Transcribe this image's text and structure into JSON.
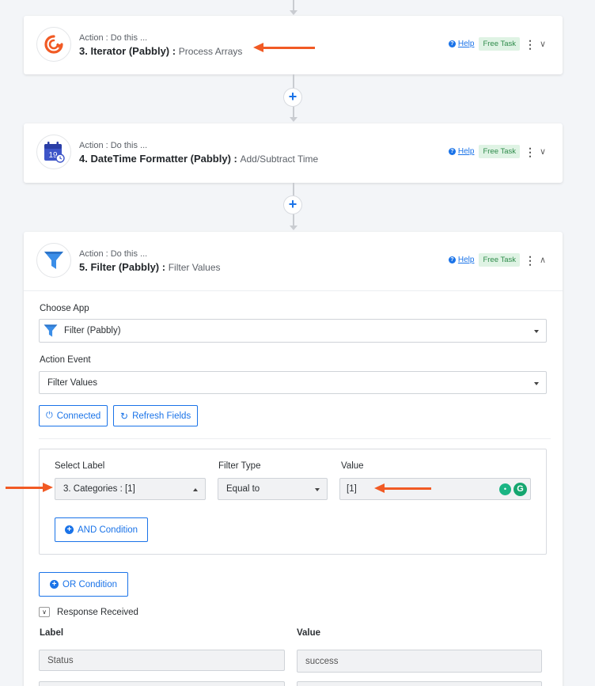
{
  "steps": [
    {
      "sub": "Action : Do this ...",
      "title": "3. Iterator (Pabbly) :",
      "event": "Process Arrays",
      "help": "Help",
      "badge": "Free Task",
      "chevron": "down"
    },
    {
      "sub": "Action : Do this ...",
      "title": "4. DateTime Formatter (Pabbly) :",
      "event": "Add/Subtract Time",
      "help": "Help",
      "badge": "Free Task",
      "chevron": "down",
      "calendar_day": "19"
    },
    {
      "sub": "Action : Do this ...",
      "title": "5. Filter (Pabbly) :",
      "event": "Filter Values",
      "help": "Help",
      "badge": "Free Task",
      "chevron": "up"
    }
  ],
  "filter_step": {
    "choose_app_label": "Choose App",
    "choose_app_value": "Filter (Pabbly)",
    "action_event_label": "Action Event",
    "action_event_value": "Filter Values",
    "connected_label": "Connected",
    "refresh_label": "Refresh Fields",
    "condition": {
      "select_label_header": "Select Label",
      "filter_type_header": "Filter Type",
      "value_header": "Value",
      "select_label_value": "3. Categories : [1]",
      "filter_type_value": "Equal to",
      "value_value": "[1]",
      "and_condition_label": "AND Condition"
    },
    "or_condition_label": "OR Condition",
    "response_label": "Response Received",
    "response_table": {
      "label_header": "Label",
      "value_header": "Value",
      "rows": [
        {
          "label": "Status",
          "value": "success"
        }
      ]
    }
  },
  "colors": {
    "accent": "#1a73e8",
    "annotation_arrow": "#f15a24",
    "badge_bg": "#dff3e4",
    "badge_text": "#2e8b4a"
  },
  "icons": [
    "iterator-icon",
    "calendar-icon",
    "funnel-icon",
    "help-icon",
    "kebab-menu-icon",
    "chevron-icon",
    "plug-icon",
    "refresh-icon",
    "grammarly-icon",
    "bulb-icon",
    "plus-icon"
  ]
}
